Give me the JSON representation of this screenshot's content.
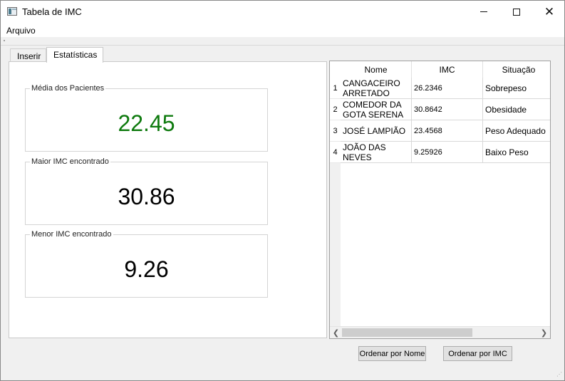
{
  "window": {
    "title": "Tabela de IMC"
  },
  "menu": {
    "items": [
      "Arquivo"
    ]
  },
  "tabs": [
    {
      "label": "Inserir",
      "active": false
    },
    {
      "label": "Estatísticas",
      "active": true
    }
  ],
  "stats": {
    "media": {
      "title": "Média dos Pacientes",
      "value": "22.45",
      "color": "#0e7a0e"
    },
    "maior": {
      "title": "Maior IMC encontrado",
      "value": "30.86",
      "color": "#000000"
    },
    "menor": {
      "title": "Menor IMC encontrado",
      "value": "9.26",
      "color": "#000000"
    }
  },
  "table": {
    "columns": [
      "Nome",
      "IMC",
      "Situação"
    ],
    "rows": [
      {
        "index": "1",
        "nome": "CANGACEIRO ARRETADO",
        "imc": "26.2346",
        "situacao": "Sobrepeso"
      },
      {
        "index": "2",
        "nome": "COMEDOR DA GOTA SERENA",
        "imc": "30.8642",
        "situacao": "Obesidade"
      },
      {
        "index": "3",
        "nome": "JOSÉ LAMPIÃO",
        "imc": "23.4568",
        "situacao": "Peso Adequado"
      },
      {
        "index": "4",
        "nome": "JOÃO DAS NEVES",
        "imc": "9.25926",
        "situacao": "Baixo Peso"
      }
    ]
  },
  "buttons": {
    "sort_by_name": "Ordenar por Nome",
    "sort_by_imc": "Ordenar por IMC"
  },
  "icons": {
    "app": "app-window-icon",
    "minimize": "minimize-icon",
    "maximize": "maximize-icon",
    "close": "close-icon",
    "scroll_left": "chevron-left-icon",
    "scroll_right": "chevron-right-icon",
    "size_grip": "size-grip-icon"
  }
}
